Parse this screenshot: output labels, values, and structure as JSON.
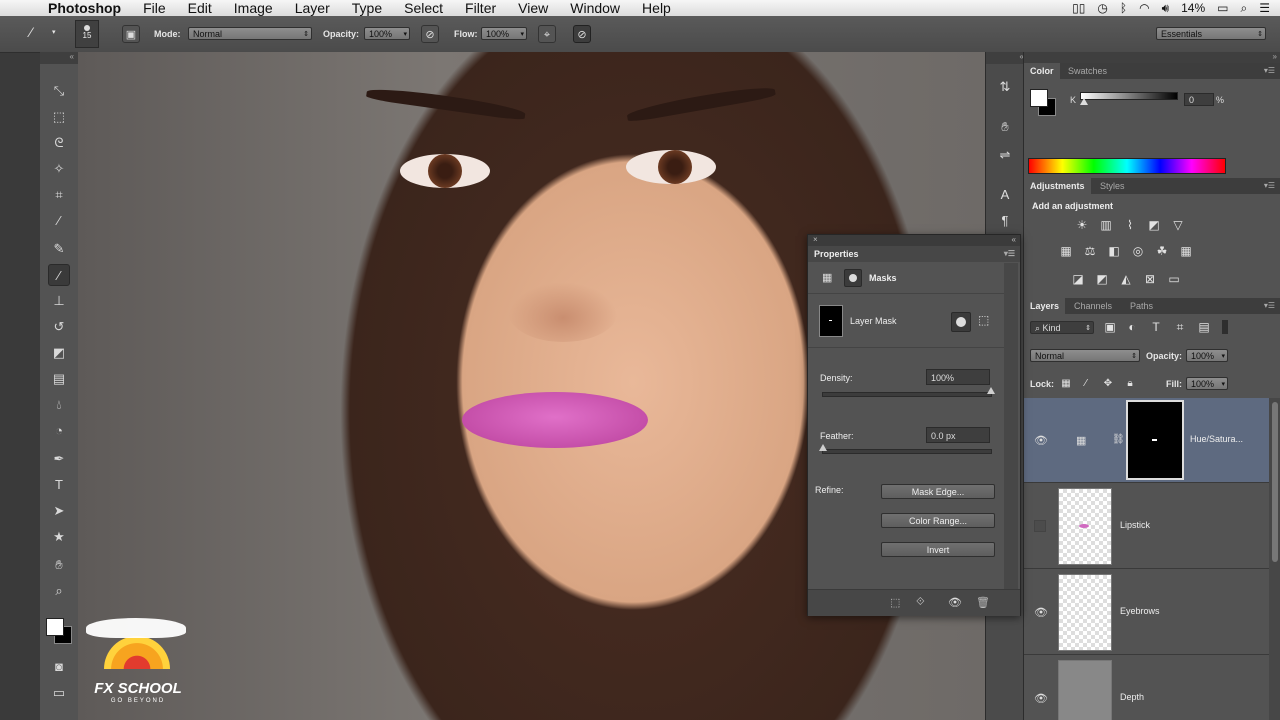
{
  "menubar": {
    "app": "Photoshop",
    "items": [
      "File",
      "Edit",
      "Image",
      "Layer",
      "Type",
      "Select",
      "Filter",
      "View",
      "Window",
      "Help"
    ],
    "battery": "14%"
  },
  "options": {
    "brush_size": "15",
    "mode_label": "Mode:",
    "mode_value": "Normal",
    "opacity_label": "Opacity:",
    "opacity_value": "100%",
    "flow_label": "Flow:",
    "flow_value": "100%",
    "workspace": "Essentials"
  },
  "color_panel": {
    "tabs": [
      "Color",
      "Swatches"
    ],
    "k_label": "K",
    "k_value": "0",
    "k_unit": "%"
  },
  "adjustments": {
    "tabs": [
      "Adjustments",
      "Styles"
    ],
    "heading": "Add an adjustment"
  },
  "properties": {
    "title": "Properties",
    "section": "Masks",
    "mask_label": "Layer Mask",
    "density_label": "Density:",
    "density_value": "100%",
    "density_level": 1.0,
    "feather_label": "Feather:",
    "feather_value": "0.0 px",
    "feather_level": 0.0,
    "refine_label": "Refine:",
    "btn_mask_edge": "Mask Edge...",
    "btn_color_range": "Color Range...",
    "btn_invert": "Invert"
  },
  "layers_panel": {
    "tabs": [
      "Layers",
      "Channels",
      "Paths"
    ],
    "kind": "Kind",
    "blend": "Normal",
    "opacity_label": "Opacity:",
    "opacity_value": "100%",
    "lock_label": "Lock:",
    "fill_label": "Fill:",
    "fill_value": "100%",
    "layers": [
      {
        "name": "Hue/Satura..."
      },
      {
        "name": "Lipstick"
      },
      {
        "name": "Eyebrows"
      },
      {
        "name": "Depth"
      }
    ]
  },
  "logo": {
    "line1": "FX SCHOOL",
    "line2": "GO BEYOND"
  }
}
